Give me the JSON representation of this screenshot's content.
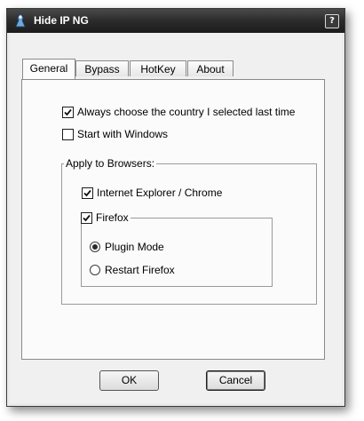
{
  "window": {
    "title": "Hide IP NG",
    "help_glyph": "?"
  },
  "tabs": [
    {
      "label": "General",
      "active": true
    },
    {
      "label": "Bypass",
      "active": false
    },
    {
      "label": "HotKey",
      "active": false
    },
    {
      "label": "About",
      "active": false
    }
  ],
  "general": {
    "always_choose_country": {
      "label": "Always choose the country I  selected last time",
      "checked": true
    },
    "start_with_windows": {
      "label": "Start with Windows",
      "checked": false
    },
    "browsers_group": {
      "title": "Apply to Browsers:",
      "ie_chrome": {
        "label": "Internet Explorer / Chrome",
        "checked": true
      },
      "firefox": {
        "label": "Firefox",
        "checked": true,
        "modes": [
          {
            "label": "Plugin Mode",
            "selected": true
          },
          {
            "label": "Restart Firefox",
            "selected": false
          }
        ]
      }
    }
  },
  "buttons": {
    "ok": "OK",
    "cancel": "Cancel"
  },
  "icons": {
    "app": "hide-ip-app-icon",
    "help": "help-icon",
    "check": "checkmark-icon"
  }
}
